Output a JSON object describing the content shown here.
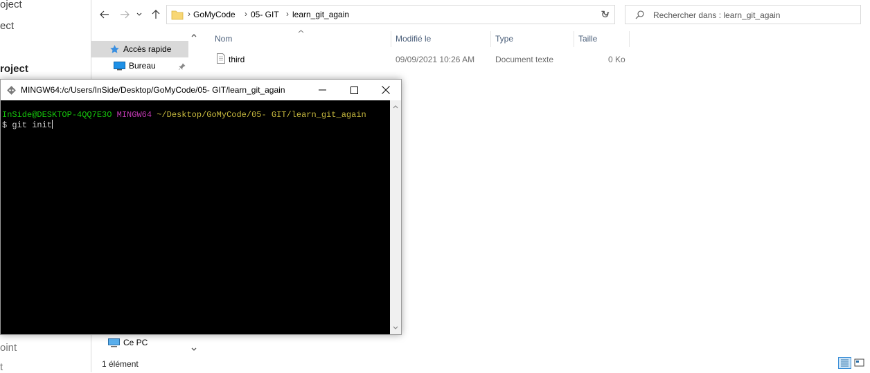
{
  "background_fragments": [
    "oject",
    "ect",
    "roject",
    "oint",
    "t"
  ],
  "explorer": {
    "breadcrumbs": [
      "GoMyCode",
      "05- GIT",
      "learn_git_again"
    ],
    "search_placeholder": "Rechercher dans : learn_git_again",
    "sidebar": {
      "items": [
        {
          "label": "Accès rapide",
          "icon": "star-icon"
        },
        {
          "label": "Bureau",
          "icon": "desktop-icon"
        },
        {
          "label": "Ce PC",
          "icon": "computer-icon"
        }
      ]
    },
    "columns": [
      "Nom",
      "Modifié le",
      "Type",
      "Taille"
    ],
    "files": [
      {
        "name": "third",
        "modified": "09/09/2021 10:26 AM",
        "type": "Document texte",
        "size": "0 Ko"
      }
    ],
    "status": "1 élément"
  },
  "terminal": {
    "title": "MINGW64:/c/Users/InSide/Desktop/GoMyCode/05- GIT/learn_git_again",
    "prompt_user": "InSide@DESKTOP-4QQ7E3O",
    "prompt_env": "MINGW64",
    "prompt_path": "~/Desktop/GoMyCode/05- GIT/learn_git_again",
    "command": "$ git init",
    "colors": {
      "user": "#16c60c",
      "env": "#c239b3",
      "path": "#c7b93e",
      "text": "#cccccc"
    }
  }
}
